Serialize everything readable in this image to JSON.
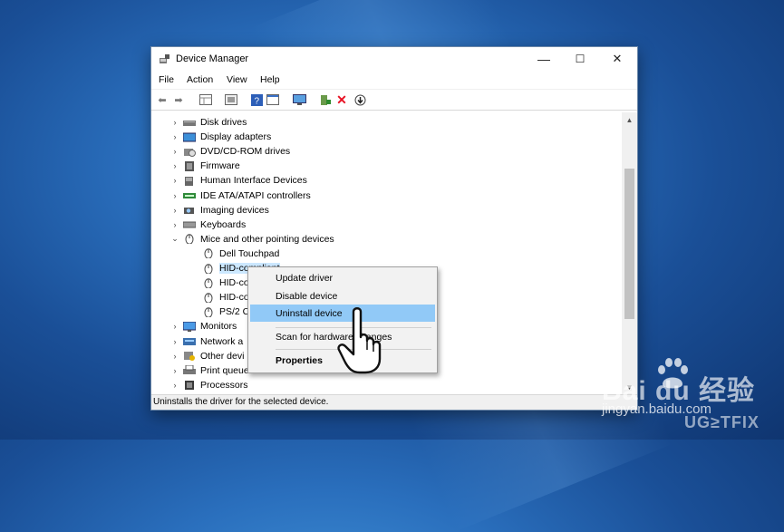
{
  "window": {
    "title": "Device Manager",
    "controls": {
      "minimize": "—",
      "maximize": "☐",
      "close": "✕"
    }
  },
  "menu": [
    "File",
    "Action",
    "View",
    "Help"
  ],
  "tree": [
    {
      "label": "Disk drives",
      "icon": "disk-drive-icon",
      "expand": "collapsed"
    },
    {
      "label": "Display adapters",
      "icon": "display-adapter-icon",
      "expand": "collapsed"
    },
    {
      "label": "DVD/CD-ROM drives",
      "icon": "dvd-drive-icon",
      "expand": "collapsed"
    },
    {
      "label": "Firmware",
      "icon": "firmware-icon",
      "expand": "collapsed"
    },
    {
      "label": "Human Interface Devices",
      "icon": "hid-icon",
      "expand": "collapsed"
    },
    {
      "label": "IDE ATA/ATAPI controllers",
      "icon": "ide-controller-icon",
      "expand": "collapsed"
    },
    {
      "label": "Imaging devices",
      "icon": "camera-icon",
      "expand": "collapsed"
    },
    {
      "label": "Keyboards",
      "icon": "keyboard-icon",
      "expand": "collapsed"
    },
    {
      "label": "Mice and other pointing devices",
      "icon": "mouse-icon",
      "expand": "expanded"
    },
    {
      "label": "Dell Touchpad",
      "icon": "mouse-icon",
      "child": true
    },
    {
      "label": "HID-compliant",
      "icon": "mouse-icon",
      "child": true,
      "selected": true
    },
    {
      "label": "HID-co",
      "icon": "mouse-icon",
      "child": true
    },
    {
      "label": "HID-co",
      "icon": "mouse-icon",
      "child": true
    },
    {
      "label": "PS/2 C",
      "icon": "mouse-icon",
      "child": true
    },
    {
      "label": "Monitors",
      "icon": "monitor-icon",
      "expand": "collapsed"
    },
    {
      "label": "Network a",
      "icon": "network-adapter-icon",
      "expand": "collapsed"
    },
    {
      "label": "Other devi",
      "icon": "other-devices-icon",
      "expand": "collapsed"
    },
    {
      "label": "Print queue",
      "icon": "printer-icon",
      "expand": "collapsed"
    },
    {
      "label": "Processors",
      "icon": "processor-icon",
      "expand": "collapsed"
    }
  ],
  "context_menu": {
    "items": [
      "Update driver",
      "Disable device",
      "Uninstall device",
      "Scan for hardware changes",
      "Properties"
    ],
    "highlighted": "Uninstall device"
  },
  "status": "Uninstalls the driver for the selected device.",
  "watermark": {
    "baidu_domain": "jingyan.baidu.com",
    "ugetfix": "UG≥TFIX"
  },
  "colors": {
    "desktop": "#2a6fbd",
    "selection": "#cce8ff",
    "menu_highlight": "#91c9f7",
    "delete_red": "#e81123"
  }
}
